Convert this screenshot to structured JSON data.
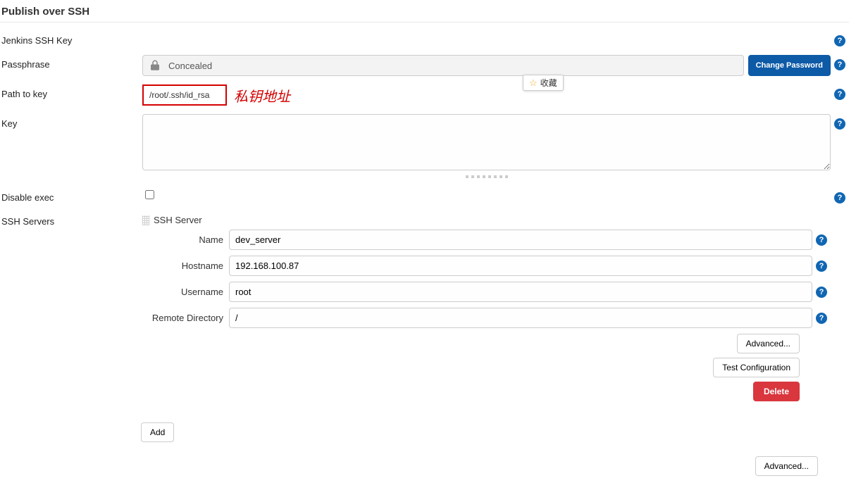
{
  "section": {
    "title": "Publish over SSH"
  },
  "jenkins_ssh_key_label": "Jenkins SSH Key",
  "passphrase": {
    "label": "Passphrase",
    "concealed_text": "Concealed",
    "change_password_btn": "Change Password"
  },
  "path_to_key": {
    "label": "Path to key",
    "value": "/root/.ssh/id_rsa",
    "annotation": "私钥地址"
  },
  "bookmark_text": "收藏",
  "key": {
    "label": "Key",
    "value": ""
  },
  "disable_exec": {
    "label": "Disable exec"
  },
  "ssh_servers": {
    "label": "SSH Servers",
    "server_heading": "SSH Server",
    "rows": {
      "name": {
        "label": "Name",
        "value": "dev_server"
      },
      "hostname": {
        "label": "Hostname",
        "value": "192.168.100.87"
      },
      "username": {
        "label": "Username",
        "value": "root"
      },
      "remote": {
        "label": "Remote Directory",
        "value": "/"
      }
    },
    "buttons": {
      "advanced": "Advanced...",
      "test_config": "Test Configuration",
      "delete": "Delete"
    }
  },
  "add_button": "Add",
  "bottom_advanced": "Advanced..."
}
